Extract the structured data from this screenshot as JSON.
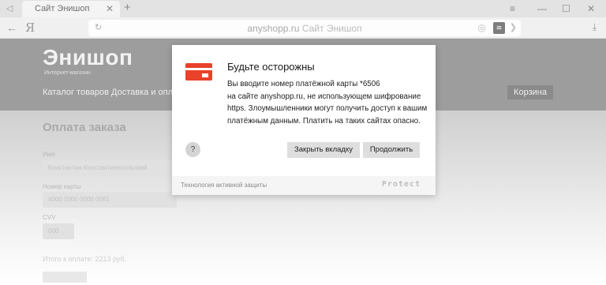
{
  "browser": {
    "tab_title": "Сайт Энишоп",
    "tab_close": "✕",
    "new_tab": "+",
    "window_controls": [
      "≡",
      "—",
      "☐",
      "✕"
    ],
    "back": "←",
    "logo": "Я",
    "reload": "↻",
    "url_host": "anyshopp.ru",
    "url_title": "Сайт Энишоп",
    "download": "⤓"
  },
  "site": {
    "logo": "Энишоп",
    "tagline": "Интернет-магазин",
    "nav": [
      "Каталог товаров",
      "Доставка и оплата"
    ],
    "cart": "Корзина",
    "form_title": "Оплата заказа",
    "fields": [
      {
        "label": "Имя",
        "value": "Константин Константинопольский"
      },
      {
        "label": "Номер карты",
        "value": "4000 0000 0000 0061"
      },
      {
        "label": "CVV",
        "value": "000"
      }
    ],
    "total": "Итого к оплате: 2213 руб."
  },
  "dialog": {
    "title": "Будьте осторожны",
    "body_lines": [
      "Вы вводите номер платёжной карты *6506",
      "на сайте anyshopp.ru, не использующем шифрование",
      "https. Злоумышленники могут получить доступ к вашим",
      "платёжным данным. Платить на таких сайтах опасно."
    ],
    "help": "?",
    "close_tab": "Закрыть вкладку",
    "continue": "Продолжить",
    "footer": "Технология активной защиты",
    "brand": "Protect"
  },
  "colors": {
    "card_icon": "#e8432a",
    "overlay_header": "#9d9d9d",
    "dialog_bg": "#ffffff"
  }
}
